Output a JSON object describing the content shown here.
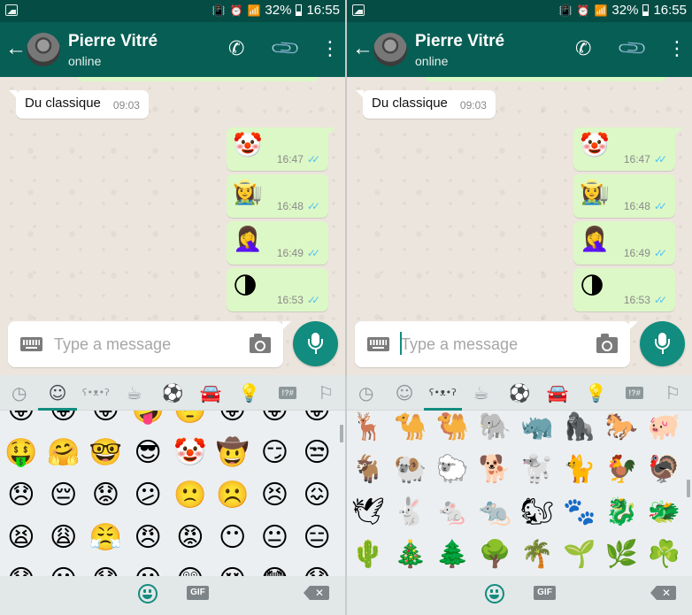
{
  "colors": {
    "status_bar": "#054d44",
    "app_bar": "#075e54",
    "accent": "#128c7e",
    "outgoing_bubble": "#dcf8c6",
    "read_ticks": "#4fc3f7"
  },
  "screens": [
    {
      "status_bar": {
        "battery": "32%",
        "time": "16:55"
      },
      "header": {
        "contact_name": "Pierre Vitré",
        "contact_status": "online"
      },
      "messages": {
        "incoming": {
          "text": "Du classique",
          "time": "09:03"
        },
        "outgoing": [
          {
            "emoji": "🤡",
            "time": "16:47",
            "status": "read"
          },
          {
            "emoji": "👩‍🌾",
            "time": "16:48",
            "status": "read"
          },
          {
            "emoji": "🤦‍♀️",
            "time": "16:49",
            "status": "read"
          },
          {
            "emoji": "🌗",
            "time": "16:53",
            "status": "read"
          }
        ]
      },
      "composer": {
        "placeholder": "Type a message",
        "value": ""
      },
      "emoji_tabs": {
        "active": "smileys",
        "items": [
          {
            "id": "recent",
            "icon": "clock-icon",
            "glyph": "◷"
          },
          {
            "id": "smileys",
            "icon": "smiley-icon",
            "glyph": "☺"
          },
          {
            "id": "animals",
            "icon": "bear-icon",
            "glyph": "ʕ•ᴥ•ʔ"
          },
          {
            "id": "food",
            "icon": "cup-icon",
            "glyph": "☕"
          },
          {
            "id": "activity",
            "icon": "soccer-ball-icon",
            "glyph": "⚽"
          },
          {
            "id": "travel",
            "icon": "car-icon",
            "glyph": "🚘"
          },
          {
            "id": "objects",
            "icon": "lightbulb-icon",
            "glyph": "💡"
          },
          {
            "id": "symbols",
            "icon": "symbols-icon",
            "glyph": "!?#"
          },
          {
            "id": "flags",
            "icon": "flag-icon",
            "glyph": "⚐"
          }
        ]
      },
      "emoji_grid": [
        "😛",
        "😝",
        "😜",
        "🤪",
        "🤨",
        "😛",
        "😝",
        "😜",
        "🤑",
        "🤗",
        "🤓",
        "😎",
        "🤡",
        "🤠",
        "😏",
        "😒",
        "😞",
        "😔",
        "😟",
        "😕",
        "🙁",
        "☹️",
        "😣",
        "😖",
        "😫",
        "😩",
        "😤",
        "😠",
        "😡",
        "😶",
        "😐",
        "😑",
        "😯",
        "😦",
        "😧",
        "😮",
        "😲",
        "😵",
        "😳",
        "😱"
      ],
      "bottom_bar": {
        "gif_label": "GIF",
        "backspace_label": "✕"
      }
    },
    {
      "status_bar": {
        "battery": "32%",
        "time": "16:55"
      },
      "header": {
        "contact_name": "Pierre Vitré",
        "contact_status": "online"
      },
      "messages": {
        "incoming": {
          "text": "Du classique",
          "time": "09:03"
        },
        "outgoing": [
          {
            "emoji": "🤡",
            "time": "16:47",
            "status": "read"
          },
          {
            "emoji": "👩‍🌾",
            "time": "16:48",
            "status": "read"
          },
          {
            "emoji": "🤦‍♀️",
            "time": "16:49",
            "status": "read"
          },
          {
            "emoji": "🌗",
            "time": "16:53",
            "status": "read"
          }
        ]
      },
      "composer": {
        "placeholder": "Type a message",
        "value": ""
      },
      "emoji_tabs": {
        "active": "animals",
        "items": [
          {
            "id": "recent",
            "icon": "clock-icon",
            "glyph": "◷"
          },
          {
            "id": "smileys",
            "icon": "smiley-icon",
            "glyph": "☺"
          },
          {
            "id": "animals",
            "icon": "bear-icon",
            "glyph": "ʕ•ᴥ•ʔ"
          },
          {
            "id": "food",
            "icon": "cup-icon",
            "glyph": "☕"
          },
          {
            "id": "activity",
            "icon": "soccer-ball-icon",
            "glyph": "⚽"
          },
          {
            "id": "travel",
            "icon": "car-icon",
            "glyph": "🚘"
          },
          {
            "id": "objects",
            "icon": "lightbulb-icon",
            "glyph": "💡"
          },
          {
            "id": "symbols",
            "icon": "symbols-icon",
            "glyph": "!?#"
          },
          {
            "id": "flags",
            "icon": "flag-icon",
            "glyph": "⚐"
          }
        ]
      },
      "emoji_grid": [
        "🦌",
        "🐪",
        "🐫",
        "🐘",
        "🦏",
        "🦍",
        "🐎",
        "🐖",
        "🐐",
        "🐏",
        "🐑",
        "🐕",
        "🐩",
        "🐈",
        "🐓",
        "🦃",
        "🕊",
        "🐇",
        "🐁",
        "🐀",
        "🐿",
        "🐾",
        "🐉",
        "🐲",
        "🌵",
        "🎄",
        "🌲",
        "🌳",
        "🌴",
        "🌱",
        "🌿",
        "☘️"
      ],
      "bottom_bar": {
        "gif_label": "GIF",
        "backspace_label": "✕"
      }
    }
  ]
}
